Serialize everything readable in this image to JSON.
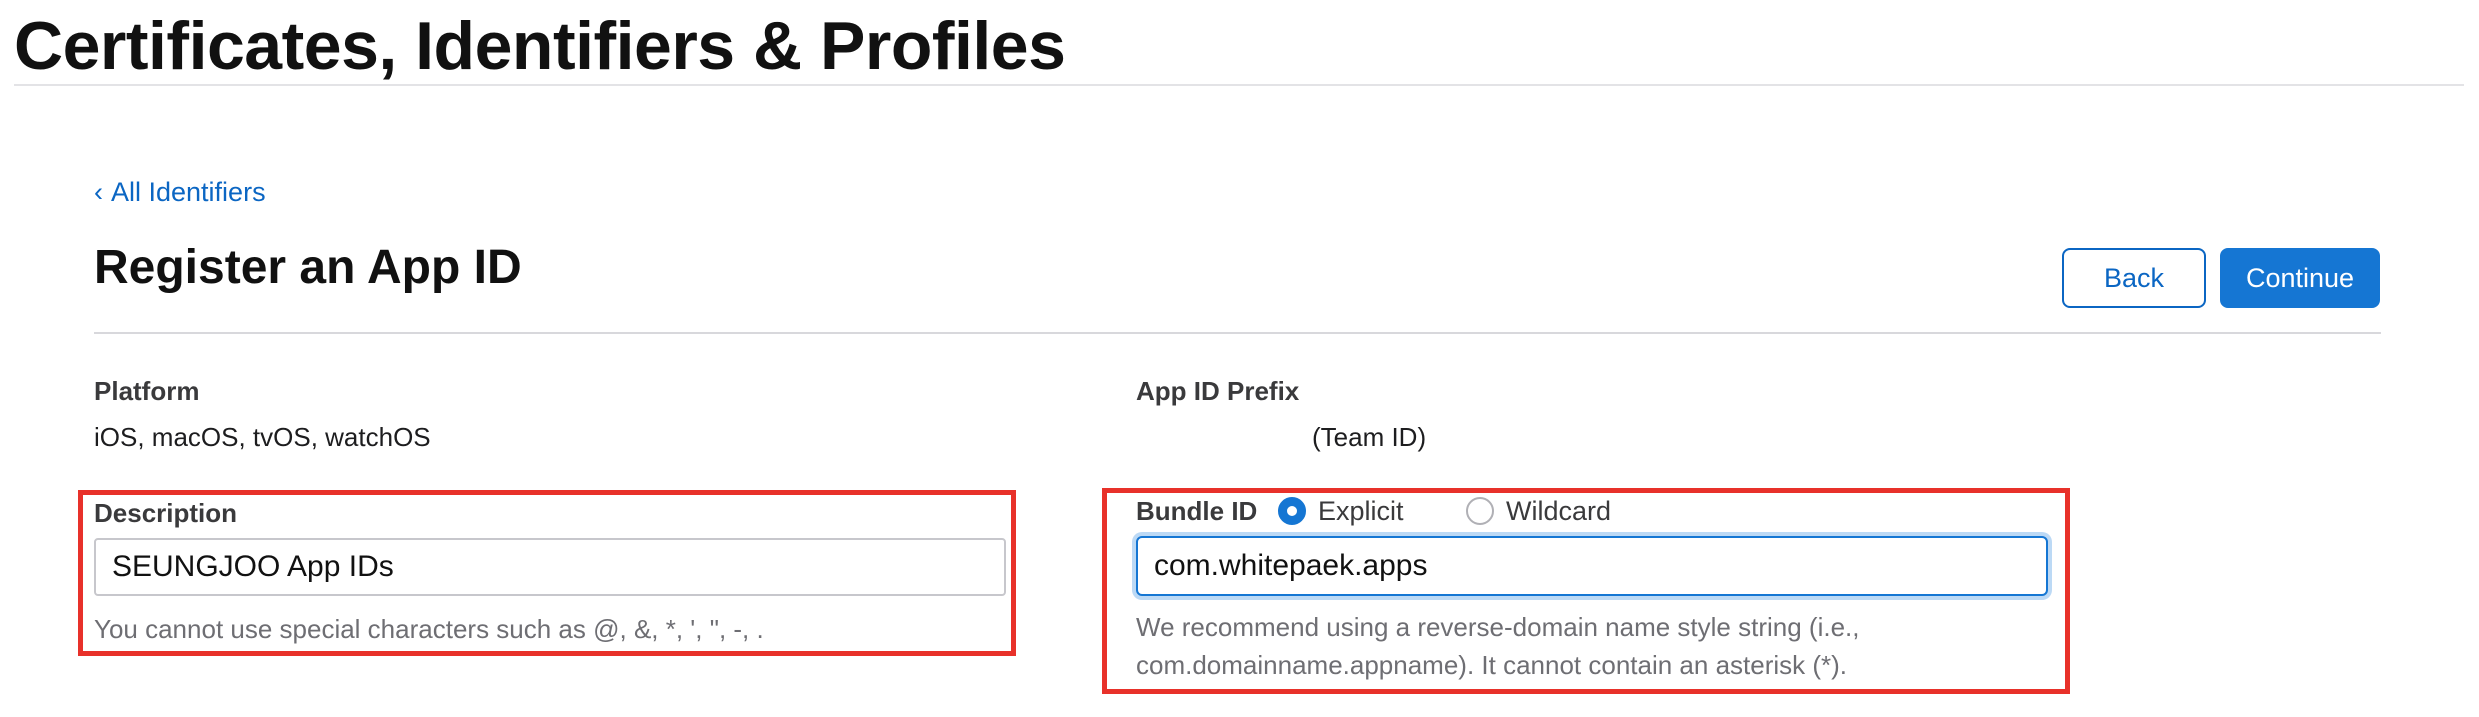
{
  "header": {
    "title": "Certificates, Identifiers & Profiles"
  },
  "nav": {
    "back_link_chevron": "‹",
    "back_link_label": "All Identifiers"
  },
  "section": {
    "title": "Register an App ID"
  },
  "buttons": {
    "back_label": "Back",
    "continue_label": "Continue"
  },
  "platform": {
    "label": "Platform",
    "value": "iOS, macOS, tvOS, watchOS"
  },
  "app_id_prefix": {
    "label": "App ID Prefix",
    "value": "(Team ID)"
  },
  "description": {
    "label": "Description",
    "value": "SEUNGJOO App IDs",
    "hint": "You cannot use special characters such as @, &, *, ', \", -, ."
  },
  "bundle_id": {
    "label": "Bundle ID",
    "options": [
      {
        "label": "Explicit",
        "selected": true
      },
      {
        "label": "Wildcard",
        "selected": false
      }
    ],
    "value": "com.whitepaek.apps",
    "hint": "We recommend using a reverse-domain name style string (i.e., com.domainname.appname). It cannot contain an asterisk (*)."
  },
  "colors": {
    "accent": "#1576d3",
    "link": "#0b66c3",
    "highlight": "#e8312a"
  }
}
